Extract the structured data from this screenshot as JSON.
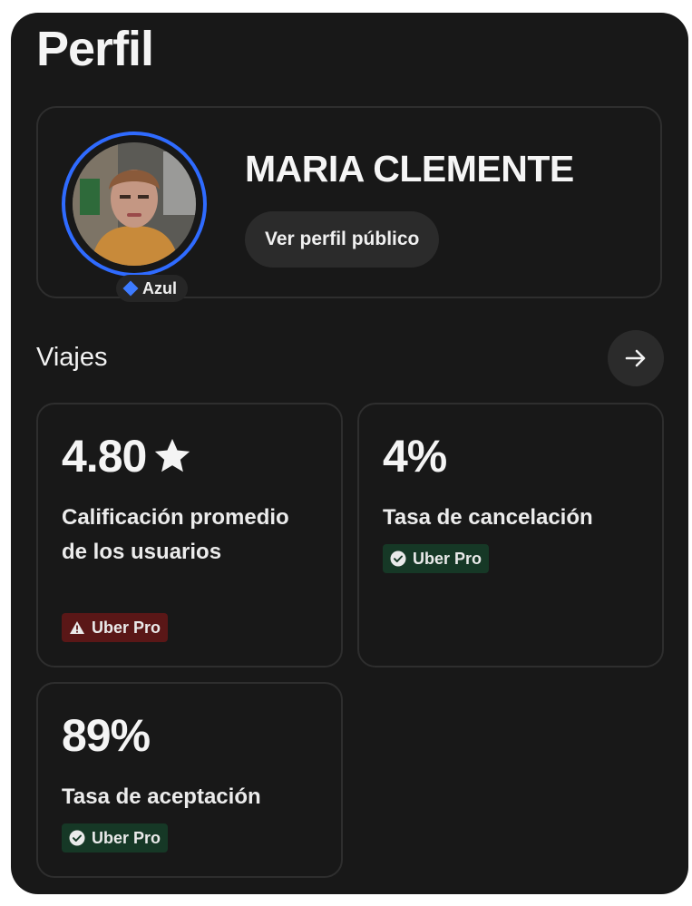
{
  "header": {
    "title": "Perfil"
  },
  "profile": {
    "name": "MARIA CLEMENTE",
    "tier_badge": "Azul",
    "view_button": "Ver perfil público"
  },
  "trips": {
    "section_title": "Viajes",
    "stats": [
      {
        "value": "4.80",
        "label": "Calificación promedio de los usuarios",
        "badge": "Uber Pro",
        "badge_status": "warning"
      },
      {
        "value": "4%",
        "label": "Tasa de cancelación",
        "badge": "Uber Pro",
        "badge_status": "ok"
      },
      {
        "value": "89%",
        "label": "Tasa de aceptación",
        "badge": "Uber Pro",
        "badge_status": "ok"
      }
    ]
  },
  "icons": {
    "tier": "diamond-icon",
    "trips_link": "arrow-right-icon",
    "rating": "star-icon",
    "warning": "warning-triangle-icon",
    "ok": "check-circle-icon"
  },
  "colors": {
    "background": "#181818",
    "tier_ring": "#2f6bff",
    "warning_badge": "#5a1717",
    "ok_badge": "#163826"
  }
}
